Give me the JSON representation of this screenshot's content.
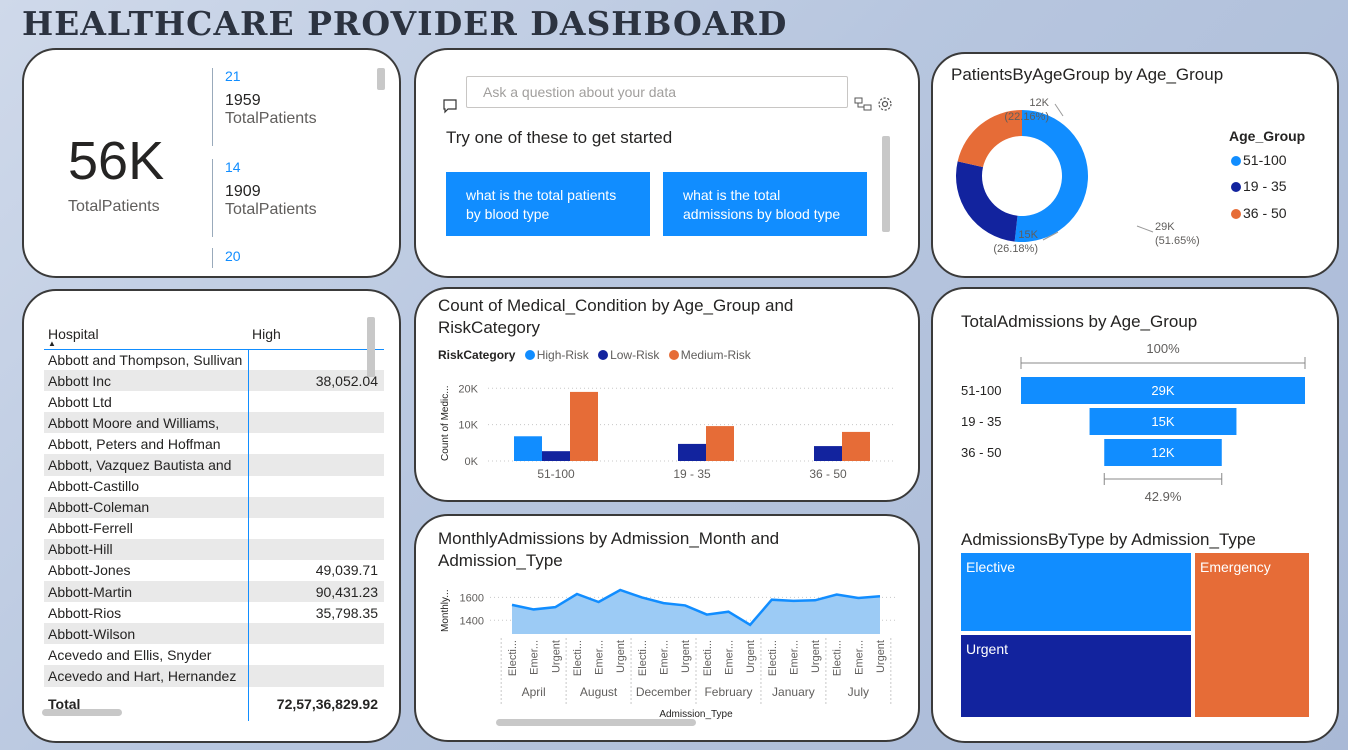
{
  "header": {
    "title": "HEALTHCARE PROVIDER DASHBOARD"
  },
  "colors": {
    "blue": "#118dff",
    "navy": "#12239e",
    "orange": "#e66c37",
    "accent_line": "#118dff"
  },
  "kpi": {
    "big_value": "56K",
    "big_label": "TotalPatients",
    "multi_row": [
      {
        "head": "21",
        "value": "1959",
        "label": "TotalPatients"
      },
      {
        "head": "14",
        "value": "1909",
        "label": "TotalPatients"
      },
      {
        "head": "20",
        "value": "",
        "label": ""
      }
    ]
  },
  "qa": {
    "placeholder": "Ask a question about your data",
    "try_text": "Try one of these to get started",
    "suggestions": [
      {
        "line1": "what is the total patients",
        "line2": "by blood type"
      },
      {
        "line1": "what is the total",
        "line2": "admissions by blood type"
      }
    ],
    "icons": [
      "chat-icon",
      "hierarchy-icon",
      "gear-icon"
    ]
  },
  "table": {
    "columns": [
      "Hospital",
      "High"
    ],
    "rows": [
      [
        "Abbott and Thompson, Sullivan",
        ""
      ],
      [
        "Abbott Inc",
        "38,052.04"
      ],
      [
        "Abbott Ltd",
        ""
      ],
      [
        "Abbott Moore and Williams,",
        ""
      ],
      [
        "Abbott, Peters and Hoffman",
        ""
      ],
      [
        "Abbott, Vazquez Bautista and",
        ""
      ],
      [
        "Abbott-Castillo",
        ""
      ],
      [
        "Abbott-Coleman",
        ""
      ],
      [
        "Abbott-Ferrell",
        ""
      ],
      [
        "Abbott-Hill",
        ""
      ],
      [
        "Abbott-Jones",
        "49,039.71"
      ],
      [
        "Abbott-Martin",
        "90,431.23"
      ],
      [
        "Abbott-Rios",
        "35,798.35"
      ],
      [
        "Abbott-Wilson",
        ""
      ],
      [
        "Acevedo and Ellis, Snyder",
        ""
      ],
      [
        "Acevedo and Hart, Hernandez",
        ""
      ]
    ],
    "total_label": "Total",
    "total_value": "72,57,36,829.92"
  },
  "chart_data": [
    {
      "type": "pie",
      "title": "PatientsByAgeGroup by Age_Group",
      "legend_title": "Age_Group",
      "legend_position": "right",
      "slices": [
        {
          "label": "51-100",
          "value": 29,
          "display": "29K",
          "pct": "(51.65%)",
          "color": "#118dff"
        },
        {
          "label": "19 - 35",
          "value": 15,
          "display": "15K",
          "pct": "(26.18%)",
          "color": "#12239e"
        },
        {
          "label": "36 - 50",
          "value": 12,
          "display": "12K",
          "pct": "(22.16%)",
          "color": "#e66c37"
        }
      ]
    },
    {
      "type": "bar",
      "title_line1": "Count of Medical_Condition by Age_Group and",
      "title_line2": "RiskCategory",
      "legend_title": "RiskCategory",
      "legend_position": "top-left",
      "ylabel": "Count of Medic...",
      "yticks": [
        "20K",
        "10K",
        "0K"
      ],
      "ylim": [
        0,
        22000
      ],
      "categories": [
        "51-100",
        "19 - 35",
        "36 - 50"
      ],
      "series": [
        {
          "name": "High-Risk",
          "color": "#118dff",
          "values": [
            6800,
            0,
            0
          ]
        },
        {
          "name": "Low-Risk",
          "color": "#12239e",
          "values": [
            2700,
            4700,
            4100
          ]
        },
        {
          "name": "Medium-Risk",
          "color": "#e66c37",
          "values": [
            19000,
            9600,
            8000
          ]
        }
      ]
    },
    {
      "type": "area",
      "title_line1": "MonthlyAdmissions by Admission_Month and",
      "title_line2": "Admission_Type",
      "ylabel": "Monthly...",
      "xlabel": "Admission_Type",
      "yticks": [
        "1600",
        "1400"
      ],
      "ylim": [
        1280,
        1700
      ],
      "x_types": [
        "Electi...",
        "Emer...",
        "Urgent",
        "Electi...",
        "Emer...",
        "Urgent",
        "Electi...",
        "Emer...",
        "Urgent",
        "Electi...",
        "Emer...",
        "Urgent",
        "Electi...",
        "Emer...",
        "Urgent",
        "Electi...",
        "Emer...",
        "Urgent"
      ],
      "months": [
        "April",
        "August",
        "December",
        "February",
        "January",
        "July"
      ],
      "values": [
        1535,
        1495,
        1515,
        1630,
        1560,
        1665,
        1600,
        1550,
        1530,
        1450,
        1475,
        1360,
        1580,
        1570,
        1575,
        1625,
        1595,
        1610
      ],
      "color": "#118dff"
    },
    {
      "type": "bar",
      "title": "TotalAdmissions by Age_Group",
      "top_pct": "100%",
      "bottom_pct": "42.9%",
      "categories": [
        "51-100",
        "19 - 35",
        "36 - 50"
      ],
      "values": [
        29,
        15,
        12
      ],
      "labels": [
        "29K",
        "15K",
        "12K"
      ],
      "color": "#118dff"
    },
    {
      "type": "heatmap",
      "title": "AdmissionsByType by Admission_Type",
      "items": [
        {
          "label": "Elective",
          "color": "#118dff"
        },
        {
          "label": "Emergency",
          "color": "#e66c37"
        },
        {
          "label": "Urgent",
          "color": "#12239e"
        }
      ]
    }
  ]
}
